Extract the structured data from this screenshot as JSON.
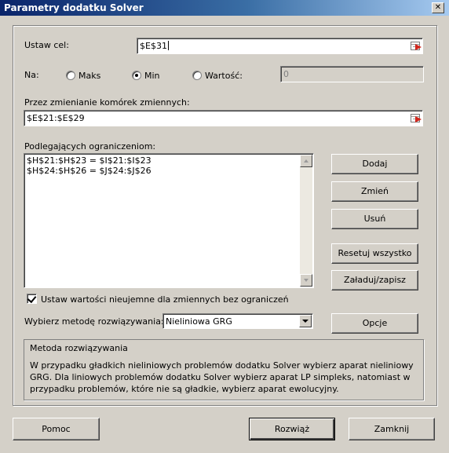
{
  "window": {
    "title": "Parametry dodatku Solver",
    "close_glyph": "✕"
  },
  "objective": {
    "label": "Ustaw cel:",
    "value": "$E$31"
  },
  "to": {
    "label": "Na:",
    "options": [
      {
        "label": "Maks",
        "selected": false
      },
      {
        "label": "Min",
        "selected": true
      },
      {
        "label": "Wartość:",
        "selected": false
      }
    ],
    "value_field": "0"
  },
  "changing_cells": {
    "label": "Przez zmienianie komórek zmiennych:",
    "value": "$E$21:$E$29"
  },
  "constraints": {
    "label": "Podlegających ograniczeniom:",
    "items": [
      "$H$21:$H$23 = $I$21:$I$23",
      "$H$24:$H$26 = $J$24:$J$26"
    ],
    "buttons": {
      "add": "Dodaj",
      "change": "Zmień",
      "delete": "Usuń",
      "reset_all": "Resetuj wszystko",
      "load_save": "Załaduj/zapisz"
    }
  },
  "nonnegative": {
    "label": "Ustaw wartości nieujemne dla zmiennych bez ograniczeń",
    "checked": true
  },
  "method": {
    "label": "Wybierz metodę rozwiązywania:",
    "selected": "Nieliniowa GRG",
    "options_button": "Opcje"
  },
  "method_info": {
    "title": "Metoda rozwiązywania",
    "text": "W przypadku gładkich nieliniowych problemów dodatku Solver wybierz aparat nieliniowy GRG. Dla liniowych problemów dodatku Solver wybierz aparat LP simpleks, natomiast w przypadku problemów, które nie są gładkie, wybierz aparat ewolucyjny."
  },
  "footer": {
    "help": "Pomoc",
    "solve": "Rozwiąż",
    "close": "Zamknij"
  },
  "icons": {
    "range_selector": "collapse-dialog-icon",
    "scroll_up": "scroll-up-arrow-icon",
    "scroll_down": "scroll-down-arrow-icon",
    "dropdown": "dropdown-arrow-icon",
    "checkbox": "checkmark-icon"
  }
}
